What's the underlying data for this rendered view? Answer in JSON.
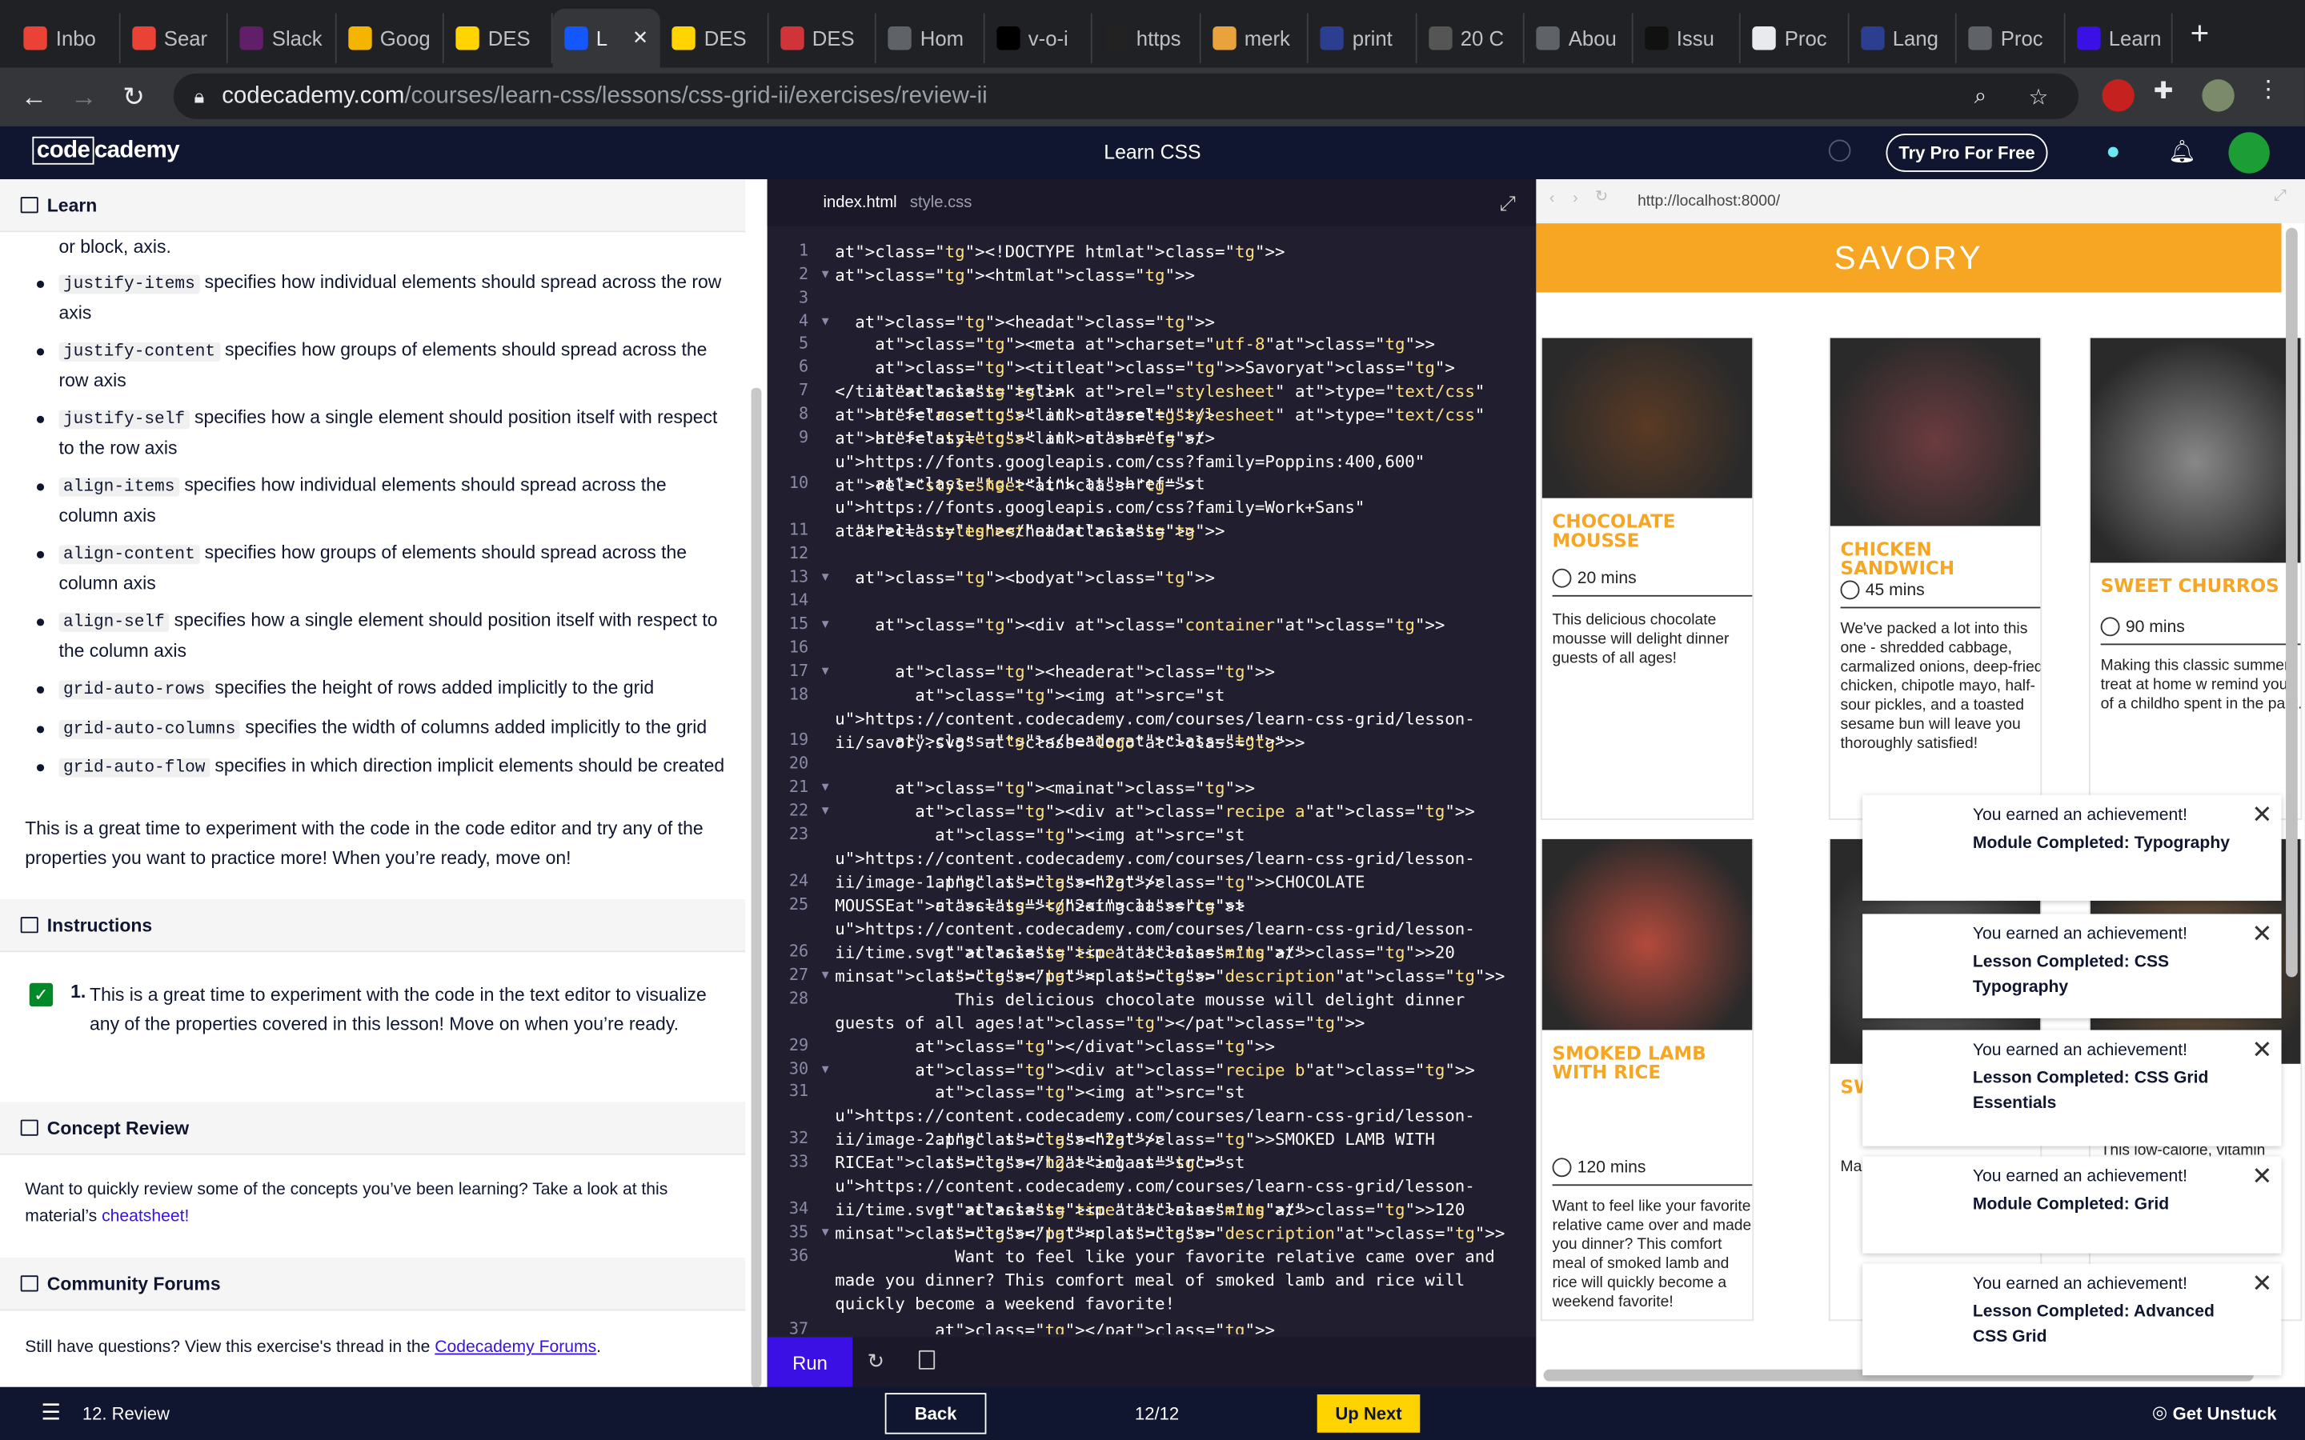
{
  "browser": {
    "tabs": [
      {
        "label": "Inbo",
        "icon": "gmail-icon",
        "color": "#ea4335"
      },
      {
        "label": "Sear",
        "icon": "gmail-icon",
        "color": "#ea4335"
      },
      {
        "label": "Slack",
        "icon": "slack-icon",
        "color": "#611f69"
      },
      {
        "label": "Goog",
        "icon": "google-slides-icon",
        "color": "#f4b400"
      },
      {
        "label": "DES",
        "icon": "des-icon",
        "color": "#ffd400"
      },
      {
        "label": "L",
        "icon": "codecademy-icon",
        "color": "#1557ff"
      },
      {
        "label": "DES",
        "icon": "des-icon",
        "color": "#ffd400"
      },
      {
        "label": "DES",
        "icon": "des-icon",
        "color": "#d13438"
      },
      {
        "label": "Hom",
        "icon": "globe-icon",
        "color": "#5f6368"
      },
      {
        "label": "v-o-i",
        "icon": "flag-icon",
        "color": "#000000"
      },
      {
        "label": "https",
        "icon": "site-icon",
        "color": "#222222"
      },
      {
        "label": "merk",
        "icon": "bookmark-icon",
        "color": "#e8a33d"
      },
      {
        "label": "print",
        "icon": "p-icon",
        "color": "#2c3e8f"
      },
      {
        "label": "20 C",
        "icon": "quote-icon",
        "color": "#555555"
      },
      {
        "label": "Abou",
        "icon": "globe-icon",
        "color": "#5f6368"
      },
      {
        "label": "Issu",
        "icon": "github-icon",
        "color": "#111111"
      },
      {
        "label": "Proc",
        "icon": "doc-icon",
        "color": "#e8eaed"
      },
      {
        "label": "Lang",
        "icon": "p-icon",
        "color": "#2c3e8f"
      },
      {
        "label": "Proc",
        "icon": "globe-icon",
        "color": "#5f6368"
      },
      {
        "label": "Learn",
        "icon": "learn-icon",
        "color": "#3a10e5"
      }
    ],
    "url_domain": "codecademy.com",
    "url_path": "/courses/learn-css/lessons/css-grid-ii/exercises/review-ii"
  },
  "header": {
    "logo_a": "code",
    "logo_b": "cademy",
    "course": "Learn CSS",
    "try_pro": "Try Pro For Free"
  },
  "learn": {
    "section": "Learn",
    "intro": "or block, axis.",
    "bullets": [
      {
        "code": "justify-items",
        "text": " specifies how individual elements should spread across the row axis"
      },
      {
        "code": "justify-content",
        "text": " specifies how groups of elements should spread across the row axis"
      },
      {
        "code": "justify-self",
        "text": " specifies how a single element should position itself with respect to the row axis"
      },
      {
        "code": "align-items",
        "text": " specifies how individual elements should spread across the column axis"
      },
      {
        "code": "align-content",
        "text": " specifies how groups of elements should spread across the column axis"
      },
      {
        "code": "align-self",
        "text": " specifies how a single element should position itself with respect to the column axis"
      },
      {
        "code": "grid-auto-rows",
        "text": " specifies the height of rows added implicitly to the grid"
      },
      {
        "code": "grid-auto-columns",
        "text": " specifies the width of columns added implicitly to the grid"
      },
      {
        "code": "grid-auto-flow",
        "text": " specifies in which direction implicit elements should be created"
      }
    ],
    "outro": "This is a great time to experiment with the code in the code editor and try any of the properties you want to practice more! When you’re ready, move on!",
    "instructions_title": "Instructions",
    "instruction_num": "1.",
    "instruction_text": "This is a great time to experiment with the code in the text editor to visualize any of the properties covered in this lesson! Move on when you’re ready.",
    "concept_title": "Concept Review",
    "concept_text": "Want to quickly review some of the concepts you’ve been learning? Take a look at this material’s ",
    "concept_link": "cheatsheet!",
    "forums_title": "Community Forums",
    "forums_text": "Still have questions? View this exercise's thread in the ",
    "forums_link": "Codecademy Forums",
    "forums_end": "."
  },
  "editor": {
    "tabs": [
      "index.html",
      "style.css"
    ],
    "run": "Run",
    "lines": [
      {
        "n": "1",
        "t": "<!DOCTYPE html>"
      },
      {
        "n": "2",
        "t": "<html>",
        "f": true
      },
      {
        "n": "3",
        "t": ""
      },
      {
        "n": "4",
        "t": "  <head>",
        "f": true
      },
      {
        "n": "5",
        "t": "    <meta charset=\"utf-8\">"
      },
      {
        "n": "6",
        "t": "    <title>Savory</title>"
      },
      {
        "n": "7",
        "t": "    <link rel=\"stylesheet\" type=\"text/css\" href=\"reset.css\" />"
      },
      {
        "n": "8",
        "t": "    <link rel=\"stylesheet\" type=\"text/css\" href=\"style.css\" />"
      },
      {
        "n": "9",
        "t": "    <link href=\"https://fonts.googleapis.com/css?family=Poppins:400,600\" rel=\"stylesheet\">"
      },
      {
        "n": "10",
        "t": "    <link href=\"https://fonts.googleapis.com/css?family=Work+Sans\" rel=\"stylesheet\">"
      },
      {
        "n": "11",
        "t": "  </head>"
      },
      {
        "n": "12",
        "t": ""
      },
      {
        "n": "13",
        "t": "  <body>",
        "f": true
      },
      {
        "n": "14",
        "t": ""
      },
      {
        "n": "15",
        "t": "    <div class=\"container\">",
        "f": true
      },
      {
        "n": "16",
        "t": ""
      },
      {
        "n": "17",
        "t": "      <header>",
        "f": true
      },
      {
        "n": "18",
        "t": "        <img src=\"https://content.codecademy.com/courses/learn-css-grid/lesson-ii/savory.svg\" class=\"logo\">"
      },
      {
        "n": "19",
        "t": "      </header>"
      },
      {
        "n": "20",
        "t": ""
      },
      {
        "n": "21",
        "t": "      <main>",
        "f": true
      },
      {
        "n": "22",
        "t": "        <div class=\"recipe a\">",
        "f": true
      },
      {
        "n": "23",
        "t": "          <img src=\"https://content.codecademy.com/courses/learn-css-grid/lesson-ii/image-1.png\" />"
      },
      {
        "n": "24",
        "t": "          <h2>CHOCOLATE MOUSSE</h2>"
      },
      {
        "n": "25",
        "t": "          <img src=\"https://content.codecademy.com/courses/learn-css-grid/lesson-ii/time.svg\" class=\"time\" />"
      },
      {
        "n": "26",
        "t": "          <p class=\"mins\">20 mins</p>"
      },
      {
        "n": "27",
        "t": "          <p class=\"description\">",
        "f": true
      },
      {
        "n": "28",
        "t": "            This delicious chocolate mousse will delight dinner guests of all ages!</p>"
      },
      {
        "n": "29",
        "t": "        </div>"
      },
      {
        "n": "30",
        "t": "        <div class=\"recipe b\">",
        "f": true
      },
      {
        "n": "31",
        "t": "          <img src=\"https://content.codecademy.com/courses/learn-css-grid/lesson-ii/image-2.png\" />"
      },
      {
        "n": "32",
        "t": "          <h2>SMOKED LAMB WITH RICE</h2>"
      },
      {
        "n": "33",
        "t": "          <img src=\"https://content.codecademy.com/courses/learn-css-grid/lesson-ii/time.svg\" class=\"time\" />"
      },
      {
        "n": "34",
        "t": "          <p class=\"mins\">120 mins</p>"
      },
      {
        "n": "35",
        "t": "          <p class=\"description\">",
        "f": true
      },
      {
        "n": "36",
        "t": "            Want to feel like your favorite relative came over and made you dinner? This comfort meal of smoked lamb and rice will quickly become a weekend favorite!"
      },
      {
        "n": "37",
        "t": "          </p>"
      }
    ]
  },
  "preview": {
    "url": "http://localhost:8000/",
    "banner": "SAVORY",
    "recipes": [
      {
        "title": "CHOCOLATE MOUSSE",
        "mins": "20 mins",
        "desc": "This delicious chocolate mousse will delight dinner guests of all ages!"
      },
      {
        "title": "CHICKEN SANDWICH",
        "mins": "45 mins",
        "desc": "We've packed a lot into this one - shredded cabbage, carmalized onions, deep-fried chicken, chipotle mayo, half-sour pickles, and a toasted sesame bun will leave you thoroughly satisfied!"
      },
      {
        "title": "SWEET CHURROS",
        "mins": "90 mins",
        "desc": "Making this classic summer treat at home w remind you of a childho spent in the park."
      },
      {
        "title": "SMOKED LAMB WITH RICE",
        "mins": "120 mins",
        "desc": "Want to feel like your favorite relative came over and made you dinner? This comfort meal of smoked lamb and rice will quickly become a weekend favorite!"
      },
      {
        "title": "SW",
        "mins": "",
        "desc": "Ma sur ren spe"
      },
      {
        "title": "",
        "mins": "",
        "desc": "This low-calorie, vitamin"
      }
    ]
  },
  "achievements": [
    {
      "line1": "You earned an achievement!",
      "line2": "Module Completed: Typography"
    },
    {
      "line1": "You earned an achievement!",
      "line2": "Lesson Completed: CSS Typography"
    },
    {
      "line1": "You earned an achievement!",
      "line2": "Lesson Completed: CSS Grid Essentials"
    },
    {
      "line1": "You earned an achievement!",
      "line2": "Module Completed: Grid"
    },
    {
      "line1": "You earned an achievement!",
      "line2": "Lesson Completed: Advanced CSS Grid"
    }
  ],
  "footer": {
    "lesson": "12. Review",
    "back": "Back",
    "progress": "12/12",
    "up_next": "Up Next",
    "unstuck": "Get Unstuck"
  }
}
